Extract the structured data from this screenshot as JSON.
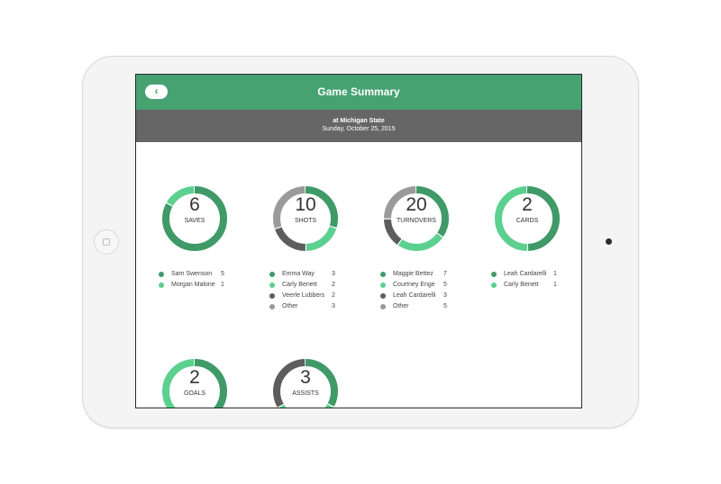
{
  "header": {
    "title": "Game Summary",
    "back_icon": "chevron-left-icon",
    "back_label": "‹"
  },
  "subheader": {
    "venue": "at Michigan State",
    "date": "Sunday, October 25, 2015"
  },
  "colors": {
    "nav_green": "#47a272",
    "dark_green": "#3f9a68",
    "light_green": "#5cd08f",
    "dark_grey": "#5d5d5d",
    "grey": "#9a9a9a"
  },
  "stats": [
    {
      "value": "6",
      "label": "SAVES",
      "players": [
        {
          "name": "Sam Swenson",
          "count": "5",
          "color": "#3f9a68"
        },
        {
          "name": "Morgan Malone",
          "count": "1",
          "color": "#5cd08f"
        }
      ]
    },
    {
      "value": "10",
      "label": "SHOTS",
      "players": [
        {
          "name": "Emma Way",
          "count": "3",
          "color": "#3f9a68"
        },
        {
          "name": "Carly Benett",
          "count": "2",
          "color": "#5cd08f"
        },
        {
          "name": "Veerle Lubbers",
          "count": "2",
          "color": "#5d5d5d"
        },
        {
          "name": "Other",
          "count": "3",
          "color": "#9a9a9a"
        }
      ]
    },
    {
      "value": "20",
      "label": "TURNOVERS",
      "players": [
        {
          "name": "Maggie Bettez",
          "count": "7",
          "color": "#3f9a68"
        },
        {
          "name": "Courtney Enge",
          "count": "5",
          "color": "#5cd08f"
        },
        {
          "name": "Leah Cardarelli",
          "count": "3",
          "color": "#5d5d5d"
        },
        {
          "name": "Other",
          "count": "5",
          "color": "#9a9a9a"
        }
      ]
    },
    {
      "value": "2",
      "label": "CARDS",
      "players": [
        {
          "name": "Leah Cardarelli",
          "count": "1",
          "color": "#3f9a68"
        },
        {
          "name": "Carly Benett",
          "count": "1",
          "color": "#5cd08f"
        }
      ]
    },
    {
      "value": "2",
      "label": "GOALS",
      "segments": [
        {
          "count": 1,
          "color": "#3f9a68"
        },
        {
          "count": 1,
          "color": "#5cd08f"
        }
      ],
      "players": []
    },
    {
      "value": "3",
      "label": "ASSISTS",
      "segments": [
        {
          "count": 1,
          "color": "#3f9a68"
        },
        {
          "count": 1,
          "color": "#5cd08f"
        },
        {
          "count": 1,
          "color": "#5d5d5d"
        }
      ],
      "players": []
    }
  ]
}
